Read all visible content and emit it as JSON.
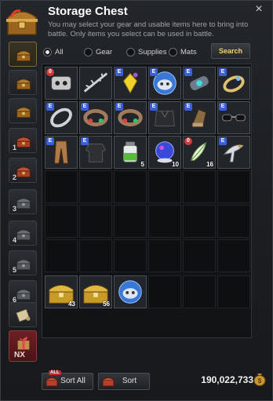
{
  "window": {
    "title": "Storage Chest",
    "description": "You may select your gear and usable items here to bring into battle. Only items you select can be used in battle.",
    "close_label": "×"
  },
  "filters": {
    "options": [
      "All",
      "Gear",
      "Supplies",
      "Mats"
    ],
    "selected": "All",
    "search_label": "Search"
  },
  "sidebar": {
    "tabs": [
      {
        "icon": "treasure-chest-icon",
        "num": ""
      },
      {
        "icon": "treasure-chest-icon",
        "num": ""
      },
      {
        "icon": "treasure-chest-icon",
        "num": ""
      },
      {
        "icon": "red-chest-icon",
        "num": "1"
      },
      {
        "icon": "red-chest-icon",
        "num": "2"
      },
      {
        "icon": "locked-chest-icon",
        "num": "3"
      },
      {
        "icon": "locked-chest-icon",
        "num": "4"
      },
      {
        "icon": "locked-chest-icon",
        "num": "5"
      },
      {
        "icon": "locked-chest-icon",
        "num": "6"
      },
      {
        "icon": "scroll-icon",
        "num": ""
      },
      {
        "icon": "gift-box-icon",
        "num": "NX"
      }
    ]
  },
  "items": [
    {
      "row": 0,
      "col": 0,
      "icon": "robot-pet-icon",
      "badge": "o",
      "count": ""
    },
    {
      "row": 0,
      "col": 1,
      "icon": "thorn-weapon-icon",
      "badge": "",
      "count": ""
    },
    {
      "row": 0,
      "col": 2,
      "icon": "yellow-gem-icon",
      "badge": "e",
      "count": ""
    },
    {
      "row": 0,
      "col": 3,
      "icon": "cat-mask-icon",
      "badge": "e",
      "count": ""
    },
    {
      "row": 0,
      "col": 4,
      "icon": "crystal-bracer-icon",
      "badge": "e",
      "count": ""
    },
    {
      "row": 0,
      "col": 5,
      "icon": "gold-ring-icon",
      "badge": "e",
      "count": ""
    },
    {
      "row": 1,
      "col": 0,
      "icon": "silver-ring-icon",
      "badge": "e",
      "count": ""
    },
    {
      "row": 1,
      "col": 1,
      "icon": "jeweled-bracelet-icon",
      "badge": "e",
      "count": ""
    },
    {
      "row": 1,
      "col": 2,
      "icon": "jeweled-bracelet-icon",
      "badge": "e",
      "count": ""
    },
    {
      "row": 1,
      "col": 3,
      "icon": "dark-armor-icon",
      "badge": "e",
      "count": ""
    },
    {
      "row": 1,
      "col": 4,
      "icon": "gauntlet-icon",
      "badge": "e",
      "count": ""
    },
    {
      "row": 1,
      "col": 5,
      "icon": "sunglasses-icon",
      "badge": "e",
      "count": ""
    },
    {
      "row": 2,
      "col": 0,
      "icon": "leather-pants-icon",
      "badge": "e",
      "count": ""
    },
    {
      "row": 2,
      "col": 1,
      "icon": "dark-shirt-icon",
      "badge": "e",
      "count": ""
    },
    {
      "row": 2,
      "col": 2,
      "icon": "potion-jar-icon",
      "badge": "",
      "count": "5"
    },
    {
      "row": 2,
      "col": 3,
      "icon": "blue-orb-icon",
      "badge": "",
      "count": "10"
    },
    {
      "row": 2,
      "col": 4,
      "icon": "feather-herb-icon",
      "badge": "o",
      "count": "16"
    },
    {
      "row": 2,
      "col": 5,
      "icon": "eagle-statue-icon",
      "badge": "e",
      "count": ""
    }
  ],
  "bottom_items": [
    {
      "col": 0,
      "icon": "gold-chest-icon",
      "count": "43"
    },
    {
      "col": 1,
      "icon": "gold-chest-icon",
      "count": "56"
    },
    {
      "col": 2,
      "icon": "cat-mask-icon",
      "count": ""
    }
  ],
  "footer": {
    "sort_all_label": "Sort All",
    "sort_all_tag": "ALL",
    "sort_label": "Sort",
    "gold_amount": "190,022,733",
    "gold_icon": "money-bag-icon"
  },
  "colors": {
    "accent_gold": "#f2d26a",
    "enhance_badge": "#3a5fd8",
    "owned_badge": "#d03a3a"
  }
}
